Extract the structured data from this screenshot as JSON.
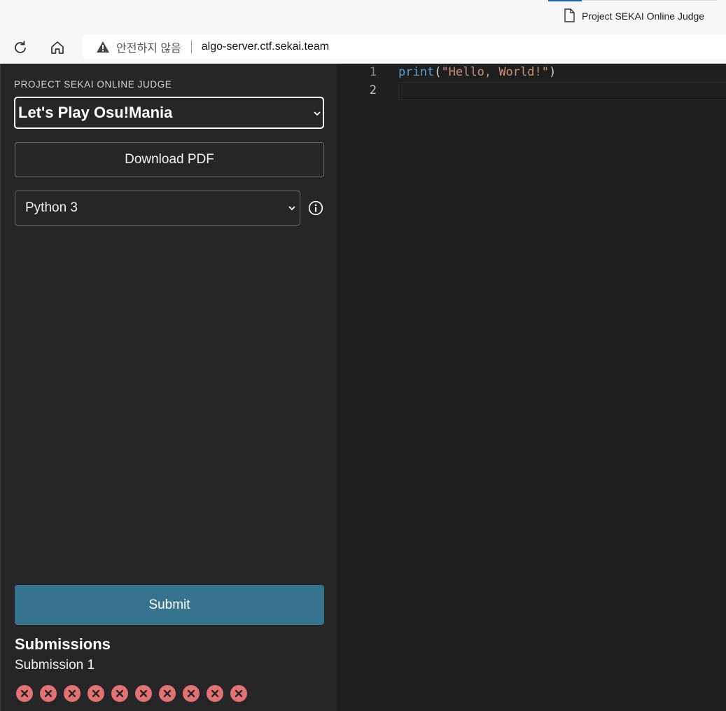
{
  "browser": {
    "tab_title": "Project SEKAI Online Judge",
    "insecure_label": "안전하지 않음",
    "url": "algo-server.ctf.sekai.team"
  },
  "sidebar": {
    "brand": "PROJECT SEKAI ONLINE JUDGE",
    "problem_selected": "Let's Play Osu!Mania",
    "download_label": "Download PDF",
    "language_selected": "Python 3",
    "submit_label": "Submit",
    "submissions_title": "Submissions",
    "submission_name": "Submission 1",
    "results": [
      "fail",
      "fail",
      "fail",
      "fail",
      "fail",
      "fail",
      "fail",
      "fail",
      "fail",
      "fail"
    ]
  },
  "editor": {
    "line_numbers": [
      "1",
      "2"
    ],
    "code": {
      "fn": "print",
      "open": "(",
      "str": "\"Hello, World!\"",
      "close": ")"
    }
  },
  "colors": {
    "sidebar_bg": "#262629",
    "editor_bg": "#1e1e1e",
    "submit_bg": "#36738f",
    "fail": "#e47272",
    "fn": "#569cd6",
    "string": "#ce9178"
  }
}
